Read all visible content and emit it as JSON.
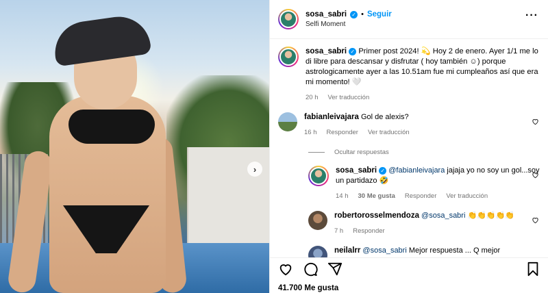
{
  "post": {
    "username": "sosa_sabri",
    "follow_label": "Seguir",
    "location": "Selfi Moment",
    "caption": "Primer post 2024! 💫 Hoy 2 de enero. Ayer 1/1 me lo di libre para descansar y disfrutar ( hoy también ☺) porque astrologicamente ayer a las 10.51am fue mi cumpleaños así que era mi momento! 🤍",
    "caption_time": "20 h",
    "see_translation": "Ver traducción",
    "likes": "41.700 Me gusta"
  },
  "comments": [
    {
      "username": "fabianleivajara",
      "text": "Gol de alexis?",
      "time": "16 h",
      "reply_label": "Responder",
      "translate_label": "Ver traducción"
    }
  ],
  "replies_toggle": "Ocultar respuestas",
  "replies": [
    {
      "username": "sosa_sabri",
      "mention": "@fabianleivajara",
      "text": "jajaja yo no soy un gol...soy un partidazo 🤣",
      "time": "14 h",
      "likes": "30 Me gusta",
      "reply_label": "Responder",
      "translate_label": "Ver traducción"
    },
    {
      "username": "robertorosselmendoza",
      "mention": "@sosa_sabri",
      "text": "👏👏👏👏👏",
      "time": "7 h",
      "reply_label": "Responder"
    },
    {
      "username": "neilalrr",
      "mention": "@sosa_sabri",
      "text": "Mejor respuesta ... Q mejor"
    }
  ],
  "icons": {
    "like": "heart-icon",
    "comment": "comment-icon",
    "share": "share-icon",
    "save": "bookmark-icon",
    "more": "more-icon",
    "next": "chevron-right-icon"
  },
  "colors": {
    "accent": "#0095f6",
    "muted": "#737373"
  }
}
